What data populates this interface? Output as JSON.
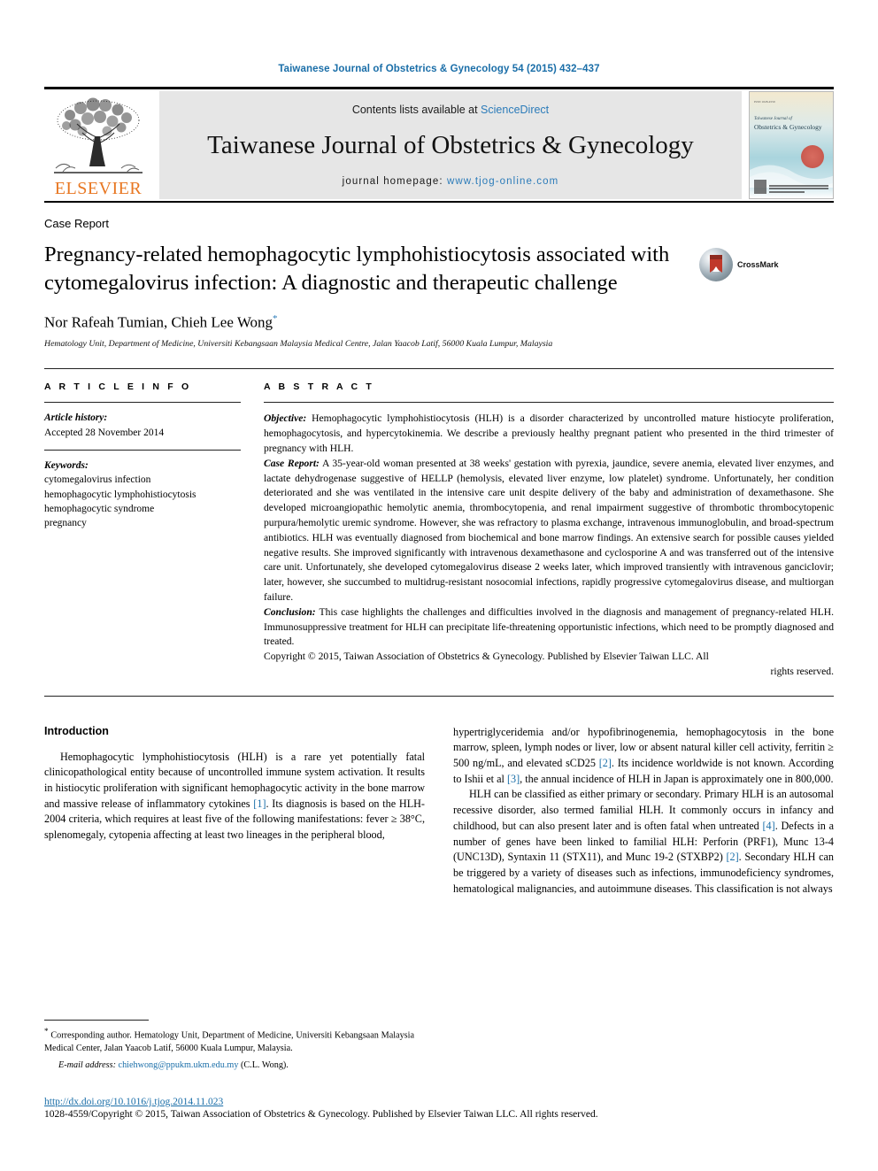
{
  "running_head": "Taiwanese Journal of Obstetrics & Gynecology 54 (2015) 432–437",
  "masthead": {
    "contents_prefix": "Contents lists available at ",
    "contents_link": "ScienceDirect",
    "journal_title": "Taiwanese Journal of Obstetrics & Gynecology",
    "homepage_prefix": "journal homepage: ",
    "homepage_url": "www.tjog-online.com",
    "publisher": "ELSEVIER",
    "cover": {
      "issn_line": "ISSN 1028-4559",
      "line1": "Taiwanese Journal of",
      "line2": "Obstetrics & Gynecology"
    }
  },
  "article": {
    "doctype": "Case Report",
    "title": "Pregnancy-related hemophagocytic lymphohistiocytosis associated with cytomegalovirus infection: A diagnostic and therapeutic challenge",
    "crossmark_label": "CrossMark",
    "authors": "Nor Rafeah Tumian, Chieh Lee Wong",
    "author_marker": "*",
    "affiliation": "Hematology Unit, Department of Medicine, Universiti Kebangsaan Malaysia Medical Centre, Jalan Yaacob Latif, 56000 Kuala Lumpur, Malaysia"
  },
  "article_info": {
    "label": "A R T I C L E   I N F O",
    "history_title": "Article history:",
    "history_value": "Accepted 28 November 2014",
    "keywords_title": "Keywords:",
    "keywords": [
      "cytomegalovirus infection",
      "hemophagocytic lymphohistiocytosis",
      "hemophagocytic syndrome",
      "pregnancy"
    ]
  },
  "abstract": {
    "label": "A B S T R A C T",
    "objective_lead": "Objective:",
    "objective_text": " Hemophagocytic lymphohistiocytosis (HLH) is a disorder characterized by uncontrolled mature histiocyte proliferation, hemophagocytosis, and hypercytokinemia. We describe a previously healthy pregnant patient who presented in the third trimester of pregnancy with HLH.",
    "case_lead": "Case Report:",
    "case_text": " A 35-year-old woman presented at 38 weeks' gestation with pyrexia, jaundice, severe anemia, elevated liver enzymes, and lactate dehydrogenase suggestive of HELLP (hemolysis, elevated liver enzyme, low platelet) syndrome. Unfortunately, her condition deteriorated and she was ventilated in the intensive care unit despite delivery of the baby and administration of dexamethasone. She developed microangiopathic hemolytic anemia, thrombocytopenia, and renal impairment suggestive of thrombotic thrombocytopenic purpura/hemolytic uremic syndrome. However, she was refractory to plasma exchange, intravenous immunoglobulin, and broad-spectrum antibiotics. HLH was eventually diagnosed from biochemical and bone marrow findings. An extensive search for possible causes yielded negative results. She improved significantly with intravenous dexamethasone and cyclosporine A and was transferred out of the intensive care unit. Unfortunately, she developed cytomegalovirus disease 2 weeks later, which improved transiently with intravenous ganciclovir; later, however, she succumbed to multidrug-resistant nosocomial infections, rapidly progressive cytomegalovirus disease, and multiorgan failure.",
    "conclusion_lead": "Conclusion:",
    "conclusion_text": " This case highlights the challenges and difficulties involved in the diagnosis and management of pregnancy-related HLH. Immunosuppressive treatment for HLH can precipitate life-threatening opportunistic infections, which need to be promptly diagnosed and treated.",
    "copyright_main": "Copyright © 2015, Taiwan Association of Obstetrics & Gynecology. Published by Elsevier Taiwan LLC. All",
    "copyright_tail": "rights reserved."
  },
  "body": {
    "intro_heading": "Introduction",
    "left_p1_a": "Hemophagocytic lymphohistiocytosis (HLH) is a rare yet potentially fatal clinicopathological entity because of uncontrolled immune system activation. It results in histiocytic proliferation with significant hemophagocytic activity in the bone marrow and massive release of inflammatory cytokines ",
    "left_p1_ref1": "[1]",
    "left_p1_b": ". Its diagnosis is based on the HLH-2004 criteria, which requires at least five of the following manifestations: fever ≥ 38°C, splenomegaly, cytopenia affecting at least two lineages in the peripheral blood,",
    "right_p1_a": "hypertriglyceridemia and/or hypofibrinogenemia, hemophagocytosis in the bone marrow, spleen, lymph nodes or liver, low or absent natural killer cell activity, ferritin ≥ 500 ng/mL, and elevated sCD25 ",
    "right_p1_ref1": "[2]",
    "right_p1_b": ". Its incidence worldwide is not known. According to Ishii et al ",
    "right_p1_ref2": "[3]",
    "right_p1_c": ", the annual incidence of HLH in Japan is approximately one in 800,000.",
    "right_p2_a": "HLH can be classified as either primary or secondary. Primary HLH is an autosomal recessive disorder, also termed familial HLH. It commonly occurs in infancy and childhood, but can also present later and is often fatal when untreated ",
    "right_p2_ref1": "[4]",
    "right_p2_b": ". Defects in a number of genes have been linked to familial HLH: Perforin (PRF1), Munc 13-4 (UNC13D), Syntaxin 11 (STX11), and Munc 19-2 (STXBP2) ",
    "right_p2_ref2": "[2]",
    "right_p2_c": ". Secondary HLH can be triggered by a variety of diseases such as infections, immunodeficiency syndromes, hematological malignancies, and autoimmune diseases. This classification is not always"
  },
  "footnotes": {
    "corresponding_marker": "*",
    "corresponding_text": " Corresponding author. Hematology Unit, Department of Medicine, Universiti Kebangsaan Malaysia Medical Center, Jalan Yaacob Latif, 56000 Kuala Lumpur, Malaysia.",
    "email_label": "E-mail address:",
    "email_address": "chiehwong@ppukm.ukm.edu.my",
    "email_suffix": " (C.L. Wong)."
  },
  "page_footer": {
    "doi": "http://dx.doi.org/10.1016/j.tjog.2014.11.023",
    "issn_copyright": "1028-4559/Copyright © 2015, Taiwan Association of Obstetrics & Gynecology. Published by Elsevier Taiwan LLC. All rights reserved."
  },
  "colors": {
    "link_blue": "#1a6ea8",
    "elsevier_orange": "#E87722",
    "masthead_grey": "#e6e6e6"
  }
}
